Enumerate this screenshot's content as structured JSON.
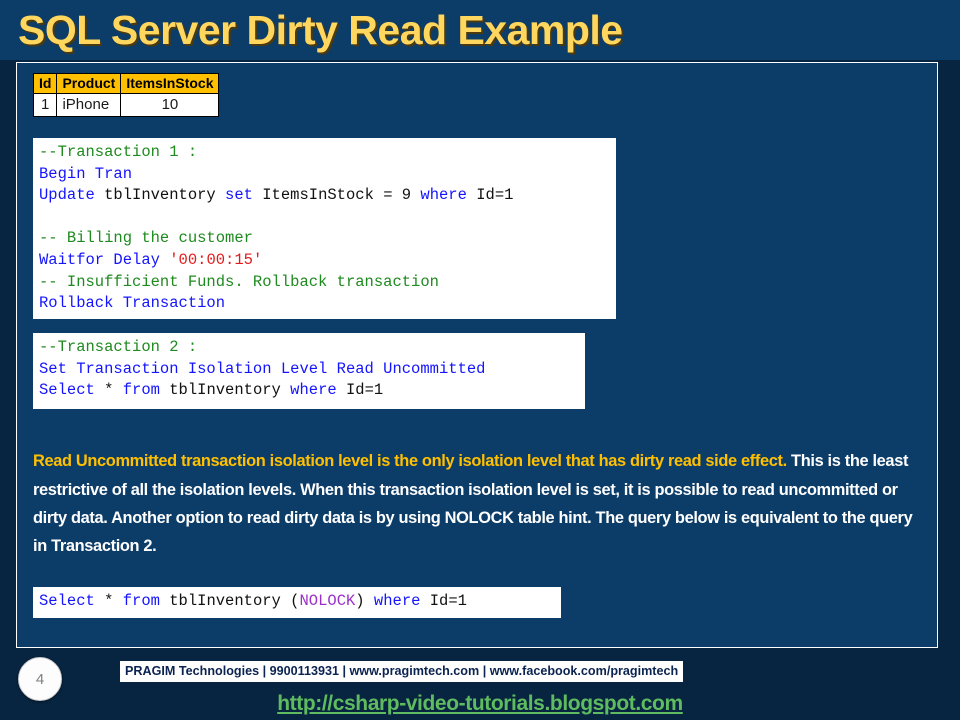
{
  "slide": {
    "title": "SQL Server Dirty Read Example",
    "page_number": "4",
    "background_color": "#072440",
    "title_band_color": "#0c3c68",
    "title_color": "#ffd75e",
    "accent_color": "#ffc000"
  },
  "table": {
    "name": "tblInventory",
    "headers": [
      "Id",
      "Product",
      "ItemsInStock"
    ],
    "rows": [
      {
        "id": "1",
        "product": "iPhone",
        "items_in_stock": "10"
      }
    ]
  },
  "code_blocks": {
    "transaction1": {
      "label": "Transaction 1",
      "lines": [
        {
          "segments": [
            {
              "text": "--Transaction 1 :",
              "style": "cmt"
            }
          ]
        },
        {
          "segments": [
            {
              "text": "Begin Tran",
              "style": "kw"
            }
          ]
        },
        {
          "segments": [
            {
              "text": "Update",
              "style": "kw"
            },
            {
              "text": " tblInventory ",
              "style": "id"
            },
            {
              "text": "set",
              "style": "kw"
            },
            {
              "text": " ItemsInStock ",
              "style": "id"
            },
            {
              "text": "=",
              "style": "id"
            },
            {
              "text": " 9 ",
              "style": "id"
            },
            {
              "text": "where",
              "style": "kw"
            },
            {
              "text": " Id=1",
              "style": "id"
            }
          ]
        },
        {
          "segments": [
            {
              "text": "",
              "style": "id"
            }
          ]
        },
        {
          "segments": [
            {
              "text": "-- Billing the customer",
              "style": "cmt"
            }
          ]
        },
        {
          "segments": [
            {
              "text": "Waitfor Delay ",
              "style": "kw"
            },
            {
              "text": "'00:00:15'",
              "style": "str"
            }
          ]
        },
        {
          "segments": [
            {
              "text": "-- Insufficient Funds. Rollback transaction",
              "style": "cmt"
            }
          ]
        },
        {
          "segments": [
            {
              "text": "Rollback Transaction",
              "style": "kw"
            }
          ]
        }
      ]
    },
    "transaction2": {
      "label": "Transaction 2",
      "lines": [
        {
          "segments": [
            {
              "text": "--Transaction 2 :",
              "style": "cmt"
            }
          ]
        },
        {
          "segments": [
            {
              "text": "Set Transaction Isolation Level Read Uncommitted",
              "style": "kw"
            }
          ]
        },
        {
          "segments": [
            {
              "text": "Select",
              "style": "kw"
            },
            {
              "text": " * ",
              "style": "id"
            },
            {
              "text": "from",
              "style": "kw"
            },
            {
              "text": " tblInventory ",
              "style": "id"
            },
            {
              "text": "where",
              "style": "kw"
            },
            {
              "text": " Id=1",
              "style": "id"
            }
          ]
        }
      ]
    },
    "nolock_query": {
      "label": "NOLOCK equivalent query",
      "lines": [
        {
          "segments": [
            {
              "text": "Select",
              "style": "kw"
            },
            {
              "text": " * ",
              "style": "id"
            },
            {
              "text": "from",
              "style": "kw"
            },
            {
              "text": " tblInventory ",
              "style": "id"
            },
            {
              "text": "(",
              "style": "id"
            },
            {
              "text": "NOLOCK",
              "style": "hint"
            },
            {
              "text": ")",
              "style": "id"
            },
            {
              "text": " ",
              "style": "id"
            },
            {
              "text": "where",
              "style": "kw"
            },
            {
              "text": " Id=1",
              "style": "id"
            }
          ]
        }
      ]
    }
  },
  "paragraph": {
    "highlighted": "Read Uncommitted transaction isolation level is the only isolation level that has dirty read side effect.",
    "rest": " This is the least restrictive of all the isolation levels. When this transaction isolation level is set, it is possible to read uncommitted or dirty data. Another option to read dirty data is by using NOLOCK table hint. The query below is equivalent to the query in Transaction 2."
  },
  "footer": {
    "credit": "PRAGIM Technologies | 9900113931 | www.pragimtech.com | www.facebook.com/pragimtech",
    "link": "http://csharp-video-tutorials.blogspot.com"
  }
}
